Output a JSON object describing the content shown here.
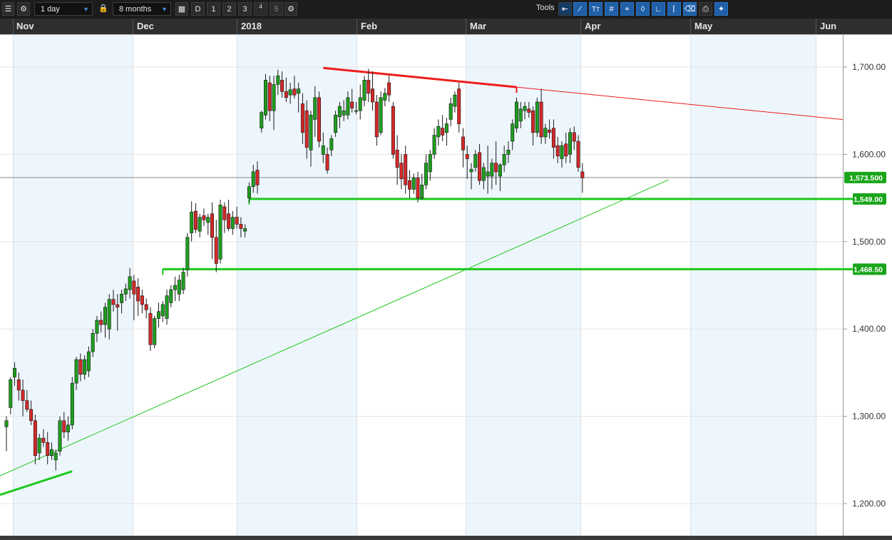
{
  "toolbar": {
    "interval": "1 day",
    "range": "8 months",
    "btn_d": "D",
    "btn_1": "1",
    "btn_2": "2",
    "btn_3": "3",
    "btn_4_sup": "4",
    "btn_5": "5",
    "tools_label": "Tools"
  },
  "months": [
    "Nov",
    "Dec",
    "2018",
    "Feb",
    "Mar",
    "Apr",
    "May",
    "Jun"
  ],
  "colors": {
    "up": "#1e9e1e",
    "down": "#d42828",
    "support": "#1ec81e",
    "resistance": "#ee1c1c",
    "price_tag": "#1aa51a",
    "shade": "#eef6fd"
  },
  "chart_data": {
    "type": "candlestick",
    "ylim": [
      1165,
      1745
    ],
    "y_ticks": [
      "1,700.00",
      "1,600.00",
      "1,500.00",
      "1,400.00",
      "1,300.00",
      "1,200.00"
    ],
    "y_tick_values": [
      1700,
      1600,
      1500,
      1400,
      1300,
      1200
    ],
    "last_price": "1,573.500",
    "last_price_value": 1573.5,
    "support_levels": [
      {
        "label": "1,549.00",
        "value": 1549.0,
        "start_index": 59
      },
      {
        "label": "1,468.50",
        "value": 1468.5,
        "start_index": 38
      }
    ],
    "candles": [
      {
        "o": 1288,
        "h": 1300,
        "l": 1260,
        "c": 1295
      },
      {
        "o": 1310,
        "h": 1345,
        "l": 1302,
        "c": 1342
      },
      {
        "o": 1345,
        "h": 1362,
        "l": 1335,
        "c": 1355
      },
      {
        "o": 1342,
        "h": 1350,
        "l": 1318,
        "c": 1330
      },
      {
        "o": 1330,
        "h": 1342,
        "l": 1300,
        "c": 1318
      },
      {
        "o": 1318,
        "h": 1330,
        "l": 1305,
        "c": 1308
      },
      {
        "o": 1308,
        "h": 1318,
        "l": 1290,
        "c": 1295
      },
      {
        "o": 1295,
        "h": 1302,
        "l": 1245,
        "c": 1255
      },
      {
        "o": 1258,
        "h": 1280,
        "l": 1250,
        "c": 1275
      },
      {
        "o": 1275,
        "h": 1285,
        "l": 1265,
        "c": 1270
      },
      {
        "o": 1270,
        "h": 1282,
        "l": 1245,
        "c": 1255
      },
      {
        "o": 1255,
        "h": 1270,
        "l": 1250,
        "c": 1262
      },
      {
        "o": 1250,
        "h": 1262,
        "l": 1238,
        "c": 1258
      },
      {
        "o": 1260,
        "h": 1300,
        "l": 1255,
        "c": 1295
      },
      {
        "o": 1295,
        "h": 1305,
        "l": 1275,
        "c": 1282
      },
      {
        "o": 1282,
        "h": 1300,
        "l": 1272,
        "c": 1290
      },
      {
        "o": 1290,
        "h": 1345,
        "l": 1285,
        "c": 1338
      },
      {
        "o": 1338,
        "h": 1368,
        "l": 1330,
        "c": 1365
      },
      {
        "o": 1365,
        "h": 1372,
        "l": 1340,
        "c": 1348
      },
      {
        "o": 1348,
        "h": 1370,
        "l": 1342,
        "c": 1365
      },
      {
        "o": 1352,
        "h": 1380,
        "l": 1345,
        "c": 1374
      },
      {
        "o": 1374,
        "h": 1400,
        "l": 1368,
        "c": 1395
      },
      {
        "o": 1395,
        "h": 1415,
        "l": 1385,
        "c": 1410
      },
      {
        "o": 1410,
        "h": 1420,
        "l": 1396,
        "c": 1405
      },
      {
        "o": 1405,
        "h": 1430,
        "l": 1390,
        "c": 1425
      },
      {
        "o": 1400,
        "h": 1440,
        "l": 1388,
        "c": 1434
      },
      {
        "o": 1434,
        "h": 1445,
        "l": 1420,
        "c": 1428
      },
      {
        "o": 1428,
        "h": 1440,
        "l": 1398,
        "c": 1425
      },
      {
        "o": 1430,
        "h": 1445,
        "l": 1418,
        "c": 1440
      },
      {
        "o": 1440,
        "h": 1452,
        "l": 1432,
        "c": 1446
      },
      {
        "o": 1445,
        "h": 1470,
        "l": 1435,
        "c": 1460
      },
      {
        "o": 1455,
        "h": 1462,
        "l": 1410,
        "c": 1440
      },
      {
        "o": 1448,
        "h": 1458,
        "l": 1415,
        "c": 1432
      },
      {
        "o": 1438,
        "h": 1445,
        "l": 1418,
        "c": 1428
      },
      {
        "o": 1428,
        "h": 1435,
        "l": 1412,
        "c": 1422
      },
      {
        "o": 1418,
        "h": 1425,
        "l": 1375,
        "c": 1382
      },
      {
        "o": 1382,
        "h": 1415,
        "l": 1378,
        "c": 1412
      },
      {
        "o": 1412,
        "h": 1430,
        "l": 1402,
        "c": 1420
      },
      {
        "o": 1415,
        "h": 1432,
        "l": 1408,
        "c": 1428
      },
      {
        "o": 1412,
        "h": 1445,
        "l": 1405,
        "c": 1438
      },
      {
        "o": 1430,
        "h": 1450,
        "l": 1425,
        "c": 1445
      },
      {
        "o": 1445,
        "h": 1460,
        "l": 1432,
        "c": 1450
      },
      {
        "o": 1440,
        "h": 1462,
        "l": 1432,
        "c": 1456
      },
      {
        "o": 1445,
        "h": 1470,
        "l": 1440,
        "c": 1465
      },
      {
        "o": 1468,
        "h": 1510,
        "l": 1460,
        "c": 1505
      },
      {
        "o": 1510,
        "h": 1546,
        "l": 1500,
        "c": 1534
      },
      {
        "o": 1535,
        "h": 1544,
        "l": 1510,
        "c": 1514
      },
      {
        "o": 1512,
        "h": 1532,
        "l": 1505,
        "c": 1528
      },
      {
        "o": 1530,
        "h": 1538,
        "l": 1518,
        "c": 1525
      },
      {
        "o": 1522,
        "h": 1532,
        "l": 1508,
        "c": 1528
      },
      {
        "o": 1532,
        "h": 1545,
        "l": 1480,
        "c": 1505
      },
      {
        "o": 1505,
        "h": 1525,
        "l": 1465,
        "c": 1475
      },
      {
        "o": 1480,
        "h": 1548,
        "l": 1475,
        "c": 1542
      },
      {
        "o": 1540,
        "h": 1545,
        "l": 1510,
        "c": 1525
      },
      {
        "o": 1532,
        "h": 1548,
        "l": 1512,
        "c": 1515
      },
      {
        "o": 1515,
        "h": 1535,
        "l": 1508,
        "c": 1528
      },
      {
        "o": 1528,
        "h": 1540,
        "l": 1515,
        "c": 1520
      },
      {
        "o": 1520,
        "h": 1528,
        "l": 1505,
        "c": 1515
      },
      {
        "o": 1512,
        "h": 1520,
        "l": 1505,
        "c": 1515
      },
      {
        "o": 1550,
        "h": 1568,
        "l": 1545,
        "c": 1563
      },
      {
        "o": 1563,
        "h": 1588,
        "l": 1556,
        "c": 1580
      },
      {
        "o": 1582,
        "h": 1592,
        "l": 1555,
        "c": 1565
      },
      {
        "o": 1630,
        "h": 1650,
        "l": 1625,
        "c": 1648
      },
      {
        "o": 1645,
        "h": 1692,
        "l": 1640,
        "c": 1685
      },
      {
        "o": 1682,
        "h": 1690,
        "l": 1638,
        "c": 1650
      },
      {
        "o": 1650,
        "h": 1690,
        "l": 1628,
        "c": 1680
      },
      {
        "o": 1680,
        "h": 1697,
        "l": 1668,
        "c": 1690
      },
      {
        "o": 1685,
        "h": 1695,
        "l": 1665,
        "c": 1672
      },
      {
        "o": 1672,
        "h": 1688,
        "l": 1660,
        "c": 1665
      },
      {
        "o": 1668,
        "h": 1682,
        "l": 1658,
        "c": 1674
      },
      {
        "o": 1675,
        "h": 1690,
        "l": 1664,
        "c": 1668
      },
      {
        "o": 1670,
        "h": 1682,
        "l": 1648,
        "c": 1675
      },
      {
        "o": 1658,
        "h": 1670,
        "l": 1612,
        "c": 1625
      },
      {
        "o": 1650,
        "h": 1662,
        "l": 1595,
        "c": 1608
      },
      {
        "o": 1605,
        "h": 1650,
        "l": 1586,
        "c": 1645
      },
      {
        "o": 1640,
        "h": 1678,
        "l": 1620,
        "c": 1665
      },
      {
        "o": 1665,
        "h": 1672,
        "l": 1608,
        "c": 1615
      },
      {
        "o": 1600,
        "h": 1625,
        "l": 1590,
        "c": 1610
      },
      {
        "o": 1600,
        "h": 1608,
        "l": 1578,
        "c": 1582
      },
      {
        "o": 1605,
        "h": 1622,
        "l": 1598,
        "c": 1618
      },
      {
        "o": 1625,
        "h": 1650,
        "l": 1620,
        "c": 1645
      },
      {
        "o": 1643,
        "h": 1660,
        "l": 1630,
        "c": 1655
      },
      {
        "o": 1645,
        "h": 1662,
        "l": 1638,
        "c": 1650
      },
      {
        "o": 1645,
        "h": 1672,
        "l": 1640,
        "c": 1665
      },
      {
        "o": 1660,
        "h": 1675,
        "l": 1648,
        "c": 1653
      },
      {
        "o": 1650,
        "h": 1660,
        "l": 1646,
        "c": 1650
      },
      {
        "o": 1650,
        "h": 1680,
        "l": 1640,
        "c": 1665
      },
      {
        "o": 1662,
        "h": 1690,
        "l": 1655,
        "c": 1685
      },
      {
        "o": 1685,
        "h": 1698,
        "l": 1660,
        "c": 1670
      },
      {
        "o": 1675,
        "h": 1695,
        "l": 1650,
        "c": 1660
      },
      {
        "o": 1660,
        "h": 1668,
        "l": 1610,
        "c": 1620
      },
      {
        "o": 1625,
        "h": 1672,
        "l": 1622,
        "c": 1665
      },
      {
        "o": 1662,
        "h": 1676,
        "l": 1655,
        "c": 1670
      },
      {
        "o": 1682,
        "h": 1690,
        "l": 1660,
        "c": 1668
      },
      {
        "o": 1655,
        "h": 1660,
        "l": 1595,
        "c": 1600
      },
      {
        "o": 1605,
        "h": 1622,
        "l": 1565,
        "c": 1585
      },
      {
        "o": 1590,
        "h": 1600,
        "l": 1560,
        "c": 1572
      },
      {
        "o": 1600,
        "h": 1610,
        "l": 1555,
        "c": 1565
      },
      {
        "o": 1570,
        "h": 1582,
        "l": 1550,
        "c": 1560
      },
      {
        "o": 1560,
        "h": 1578,
        "l": 1555,
        "c": 1573
      },
      {
        "o": 1573,
        "h": 1580,
        "l": 1545,
        "c": 1550
      },
      {
        "o": 1550,
        "h": 1578,
        "l": 1548,
        "c": 1565
      },
      {
        "o": 1565,
        "h": 1600,
        "l": 1560,
        "c": 1590
      },
      {
        "o": 1580,
        "h": 1605,
        "l": 1570,
        "c": 1600
      },
      {
        "o": 1600,
        "h": 1630,
        "l": 1595,
        "c": 1622
      },
      {
        "o": 1620,
        "h": 1640,
        "l": 1610,
        "c": 1632
      },
      {
        "o": 1630,
        "h": 1645,
        "l": 1615,
        "c": 1622
      },
      {
        "o": 1625,
        "h": 1642,
        "l": 1610,
        "c": 1635
      },
      {
        "o": 1640,
        "h": 1665,
        "l": 1632,
        "c": 1658
      },
      {
        "o": 1655,
        "h": 1672,
        "l": 1648,
        "c": 1668
      },
      {
        "o": 1675,
        "h": 1682,
        "l": 1625,
        "c": 1635
      },
      {
        "o": 1620,
        "h": 1630,
        "l": 1585,
        "c": 1605
      },
      {
        "o": 1600,
        "h": 1610,
        "l": 1572,
        "c": 1595
      },
      {
        "o": 1580,
        "h": 1590,
        "l": 1560,
        "c": 1583
      },
      {
        "o": 1585,
        "h": 1605,
        "l": 1580,
        "c": 1600
      },
      {
        "o": 1602,
        "h": 1612,
        "l": 1565,
        "c": 1570
      },
      {
        "o": 1570,
        "h": 1590,
        "l": 1560,
        "c": 1585
      },
      {
        "o": 1575,
        "h": 1610,
        "l": 1555,
        "c": 1580
      },
      {
        "o": 1575,
        "h": 1595,
        "l": 1560,
        "c": 1590
      },
      {
        "o": 1590,
        "h": 1615,
        "l": 1565,
        "c": 1580
      },
      {
        "o": 1575,
        "h": 1590,
        "l": 1558,
        "c": 1588
      },
      {
        "o": 1588,
        "h": 1610,
        "l": 1580,
        "c": 1600
      },
      {
        "o": 1600,
        "h": 1615,
        "l": 1590,
        "c": 1605
      },
      {
        "o": 1615,
        "h": 1640,
        "l": 1605,
        "c": 1635
      },
      {
        "o": 1630,
        "h": 1665,
        "l": 1625,
        "c": 1660
      },
      {
        "o": 1638,
        "h": 1660,
        "l": 1630,
        "c": 1652
      },
      {
        "o": 1650,
        "h": 1660,
        "l": 1640,
        "c": 1655
      },
      {
        "o": 1652,
        "h": 1660,
        "l": 1642,
        "c": 1648
      },
      {
        "o": 1650,
        "h": 1655,
        "l": 1610,
        "c": 1625
      },
      {
        "o": 1625,
        "h": 1665,
        "l": 1620,
        "c": 1660
      },
      {
        "o": 1660,
        "h": 1675,
        "l": 1612,
        "c": 1620
      },
      {
        "o": 1620,
        "h": 1635,
        "l": 1612,
        "c": 1630
      },
      {
        "o": 1628,
        "h": 1640,
        "l": 1618,
        "c": 1625
      },
      {
        "o": 1630,
        "h": 1640,
        "l": 1595,
        "c": 1608
      },
      {
        "o": 1610,
        "h": 1620,
        "l": 1590,
        "c": 1598
      },
      {
        "o": 1595,
        "h": 1615,
        "l": 1585,
        "c": 1610
      },
      {
        "o": 1612,
        "h": 1625,
        "l": 1590,
        "c": 1598
      },
      {
        "o": 1600,
        "h": 1630,
        "l": 1590,
        "c": 1625
      },
      {
        "o": 1625,
        "h": 1632,
        "l": 1605,
        "c": 1615
      },
      {
        "o": 1615,
        "h": 1622,
        "l": 1580,
        "c": 1585
      },
      {
        "o": 1580,
        "h": 1590,
        "l": 1556,
        "c": 1573
      }
    ],
    "trendlines": [
      {
        "name": "resistance",
        "from": [
          77,
          1699
        ],
        "to": [
          124,
          1677
        ],
        "extend_to_index": 162
      },
      {
        "name": "rising_support",
        "from": [
          -12,
          1210
        ],
        "to": [
          161,
          1571
        ]
      }
    ]
  }
}
